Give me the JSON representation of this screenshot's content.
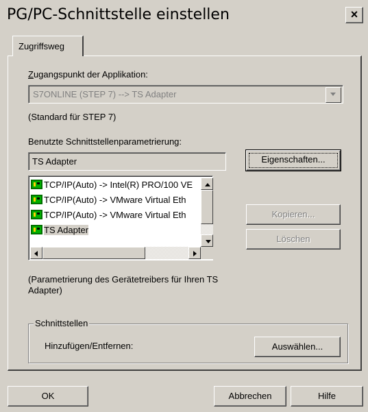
{
  "window": {
    "title": "PG/PC-Schnittstelle einstellen",
    "close_glyph": "×"
  },
  "tabs": [
    {
      "label": "Zugriffsweg",
      "active": true
    }
  ],
  "access_point": {
    "label": "Zugangspunkt der Applikation:",
    "value": "S7ONLINE     (STEP 7)     --> TS Adapter",
    "note": "(Standard für STEP 7)"
  },
  "interface_param": {
    "label": "Benutzte Schnittstellenparametrierung:",
    "value": "TS Adapter",
    "properties_button": "Eigenschaften..."
  },
  "interface_list": {
    "items": [
      {
        "label": "TCP/IP(Auto) -> Intel(R) PRO/100 VE",
        "icon": "network-adapter-icon",
        "selected": false
      },
      {
        "label": "TCP/IP(Auto) -> VMware Virtual Eth",
        "icon": "network-adapter-icon",
        "selected": false
      },
      {
        "label": "TCP/IP(Auto) -> VMware Virtual Eth",
        "icon": "network-adapter-icon",
        "selected": false
      },
      {
        "label": "TS Adapter",
        "icon": "network-adapter-icon",
        "selected": true
      }
    ]
  },
  "buttons": {
    "copy": "Kopieren...",
    "delete": "Löschen",
    "select": "Auswählen...",
    "ok": "OK",
    "cancel": "Abbrechen",
    "help": "Hilfe"
  },
  "description": "(Parametrierung des Gerätetreibers für Ihren TS Adapter)",
  "interfaces_group": {
    "title": "Schnittstellen",
    "add_remove_label": "Hinzufügen/Entfernen:"
  },
  "colors": {
    "face": "#d4d0c8",
    "shadow": "#808080",
    "icon_green": "#00a000"
  }
}
